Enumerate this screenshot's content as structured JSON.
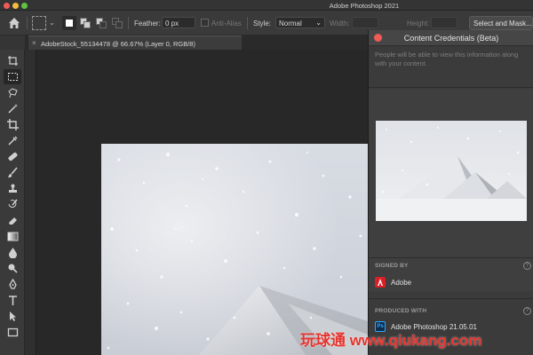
{
  "app": {
    "title": "Adobe Photoshop 2021"
  },
  "options": {
    "feather_label": "Feather:",
    "feather_value": "0 px",
    "antialias_label": "Anti-Alias",
    "style_label": "Style:",
    "style_value": "Normal",
    "width_label": "Width:",
    "height_label": "Height:",
    "mask_button": "Select and Mask..."
  },
  "document": {
    "tab_label": "AdobeStock_55134478 @ 66.67% (Layer 0, RGB/8)"
  },
  "toolbar": {
    "tools": [
      "move-tool",
      "artboard-tool",
      "rectangular-marquee-tool",
      "lasso-tool",
      "magic-wand-tool",
      "crop-tool",
      "eyedropper-tool",
      "spot-healing-tool",
      "brush-tool",
      "clone-stamp-tool",
      "history-brush-tool",
      "eraser-tool",
      "gradient-tool",
      "blur-tool",
      "dodge-tool",
      "pen-tool",
      "type-tool",
      "path-selection-tool",
      "rectangle-tool"
    ],
    "active": "rectangular-marquee-tool"
  },
  "panel": {
    "title": "Content Credentials (Beta)",
    "description": "People will be able to view this information along with your content.",
    "signed_by_label": "SIGNED BY",
    "signed_by_value": "Adobe",
    "produced_with_label": "PRODUCED WITH",
    "produced_with_value": "Adobe Photoshop 21.05.01",
    "help_glyph": "?"
  },
  "watermark": {
    "text": "玩球通 www.qiukang.com"
  },
  "colors": {
    "accent": "#31a8ff",
    "adobe_red": "#da1f26"
  }
}
